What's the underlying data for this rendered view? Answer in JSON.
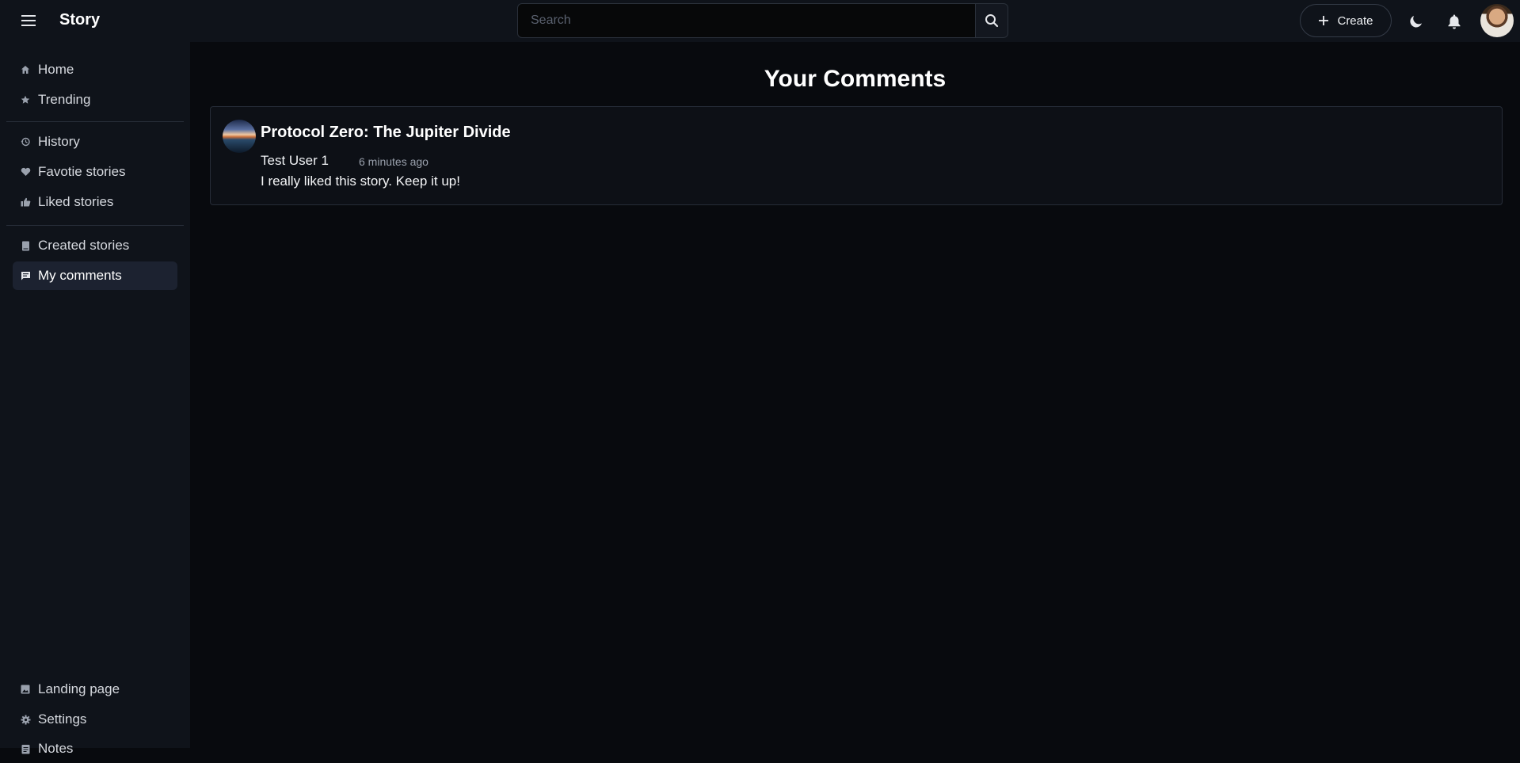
{
  "app": {
    "brand": "Story"
  },
  "header": {
    "search": {
      "placeholder": "Search",
      "value": ""
    },
    "create_label": "Create"
  },
  "sidebar": {
    "items": [
      {
        "label": "Home",
        "icon": "home-icon"
      },
      {
        "label": "Trending",
        "icon": "star-icon"
      },
      {
        "label": "History",
        "icon": "history-icon"
      },
      {
        "label": "Favotie stories",
        "icon": "heart-icon"
      },
      {
        "label": "Liked stories",
        "icon": "thumbs-up-icon"
      },
      {
        "label": "Created stories",
        "icon": "book-icon"
      },
      {
        "label": "My comments",
        "icon": "comment-icon",
        "active": true
      },
      {
        "label": "Landing page",
        "icon": "image-icon"
      },
      {
        "label": "Settings",
        "icon": "gear-icon"
      },
      {
        "label": "Notes",
        "icon": "notes-icon"
      }
    ]
  },
  "main": {
    "title": "Your Comments",
    "comments": [
      {
        "story_title": "Protocol Zero: The Jupiter Divide",
        "author": "Test User 1",
        "time": "6 minutes ago",
        "text": "I really liked this story. Keep it up!"
      }
    ]
  },
  "colors": {
    "background": "#080a0e",
    "panel": "#0f131a",
    "active_item": "#1c2230",
    "text": "#e6e8ec"
  }
}
